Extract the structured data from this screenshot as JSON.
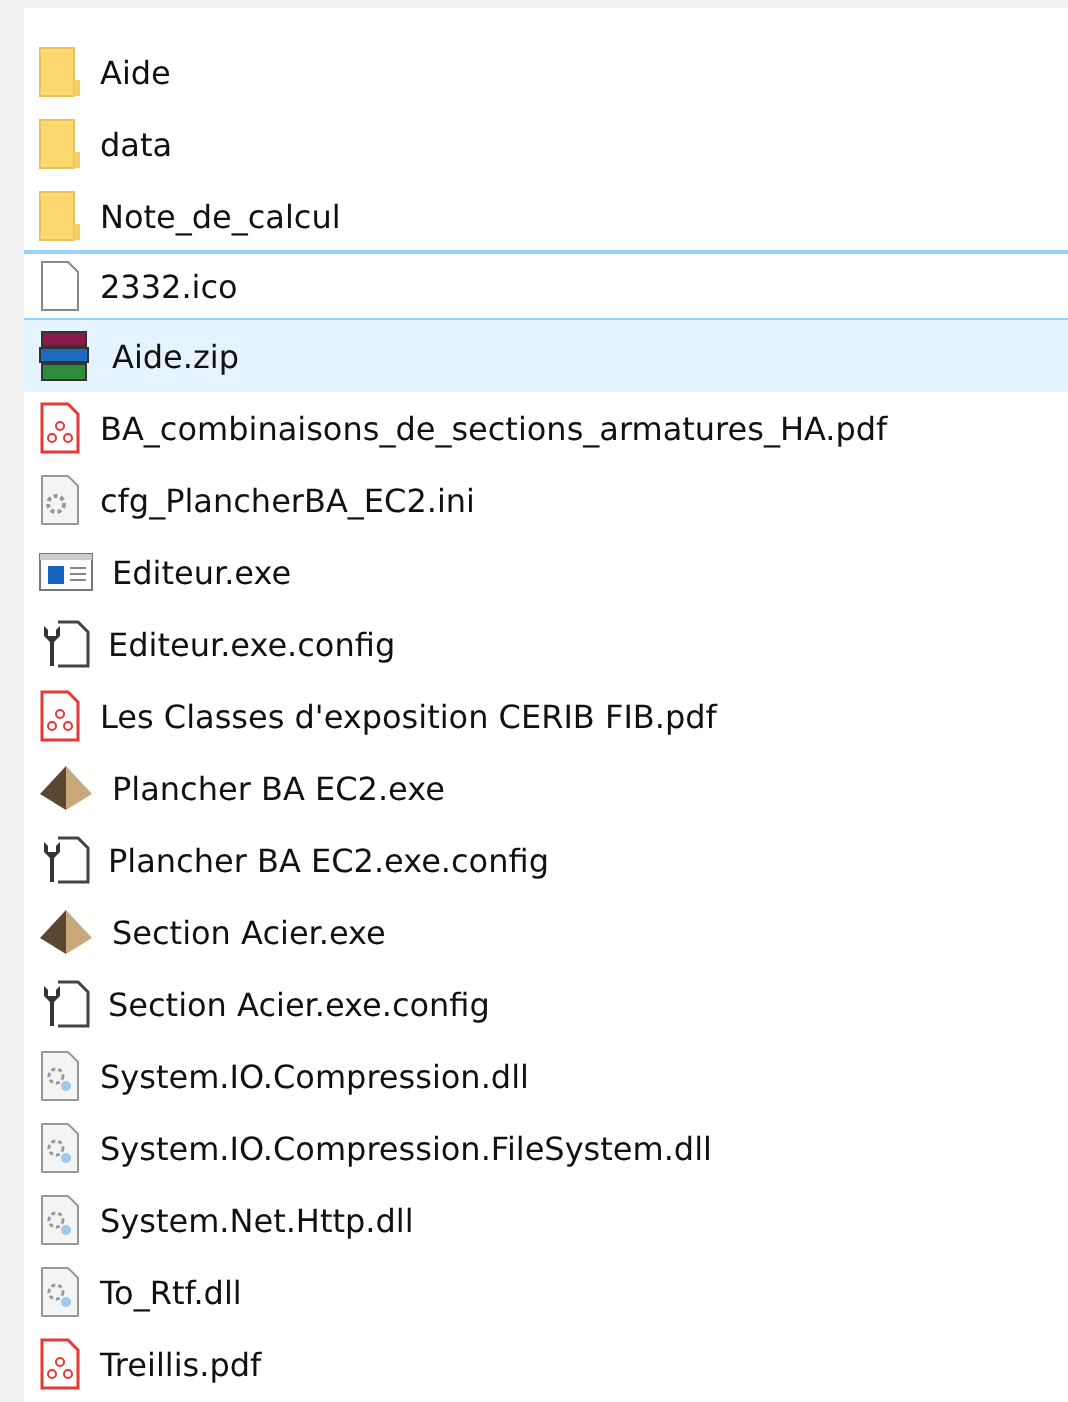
{
  "files": [
    {
      "name": "Aide",
      "kind": "folder",
      "selected": false,
      "focused": false
    },
    {
      "name": "data",
      "kind": "folder",
      "selected": false,
      "focused": false
    },
    {
      "name": "Note_de_calcul",
      "kind": "folder",
      "selected": false,
      "focused": false
    },
    {
      "name": "2332.ico",
      "kind": "blank",
      "selected": false,
      "focused": true
    },
    {
      "name": "Aide.zip",
      "kind": "archive",
      "selected": true,
      "focused": false
    },
    {
      "name": "BA_combinaisons_de_sections_armatures_HA.pdf",
      "kind": "pdf",
      "selected": false,
      "focused": false
    },
    {
      "name": "cfg_PlancherBA_EC2.ini",
      "kind": "settings",
      "selected": false,
      "focused": false
    },
    {
      "name": "Editeur.exe",
      "kind": "window",
      "selected": false,
      "focused": false
    },
    {
      "name": "Editeur.exe.config",
      "kind": "config",
      "selected": false,
      "focused": false
    },
    {
      "name": "Les Classes d'exposition CERIB FIB.pdf",
      "kind": "pdf",
      "selected": false,
      "focused": false
    },
    {
      "name": "Plancher BA EC2.exe",
      "kind": "pyramid",
      "selected": false,
      "focused": false
    },
    {
      "name": "Plancher BA EC2.exe.config",
      "kind": "config",
      "selected": false,
      "focused": false
    },
    {
      "name": "Section Acier.exe",
      "kind": "pyramid",
      "selected": false,
      "focused": false
    },
    {
      "name": "Section Acier.exe.config",
      "kind": "config",
      "selected": false,
      "focused": false
    },
    {
      "name": "System.IO.Compression.dll",
      "kind": "dll",
      "selected": false,
      "focused": false
    },
    {
      "name": "System.IO.Compression.FileSystem.dll",
      "kind": "dll",
      "selected": false,
      "focused": false
    },
    {
      "name": "System.Net.Http.dll",
      "kind": "dll",
      "selected": false,
      "focused": false
    },
    {
      "name": "To_Rtf.dll",
      "kind": "dll",
      "selected": false,
      "focused": false
    },
    {
      "name": "Treillis.pdf",
      "kind": "pdf",
      "selected": false,
      "focused": false
    }
  ]
}
